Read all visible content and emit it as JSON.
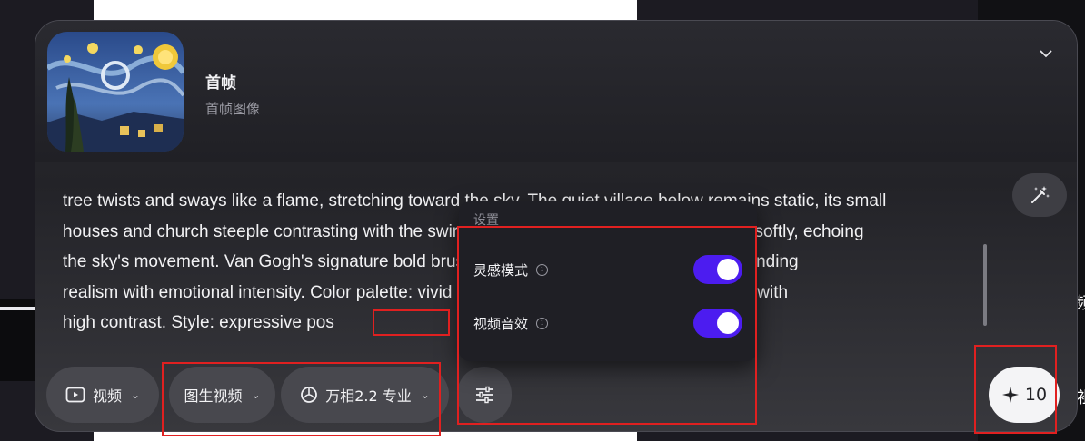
{
  "first_frame": {
    "title": "首帧",
    "subtitle": "首帧图像"
  },
  "prompt": {
    "lines": [
      "tree twists and sways like a flame, stretching toward the sky. The quiet village below remains static, its small",
      "houses and church steeple contrasting with the swirling heavens. Distant mountains ripple softly, echoing",
      "the sky's movement. Van Gogh's signature bold brushstrokes animate the entire scene, blending",
      "realism with emotional intensity. Color palette: vivid cobalt blue, yellow and emerald green, with",
      "high contrast. Style: expressive pos"
    ]
  },
  "toolbar": {
    "mode_label": "视频",
    "generation_type_label": "图生视频",
    "model_label": "万相2.2 专业",
    "generate_cost": "10"
  },
  "settings_popover": {
    "title": "设置",
    "options": [
      {
        "label": "灵感模式",
        "enabled": true
      },
      {
        "label": "视频音效",
        "enabled": true
      }
    ]
  },
  "background": {
    "right_glyph_1": "频",
    "right_glyph_2": "袓"
  },
  "colors": {
    "toggle_on": "#4c1cf0",
    "annotation_red": "#e02020",
    "panel_bg": "#2b2b31"
  }
}
